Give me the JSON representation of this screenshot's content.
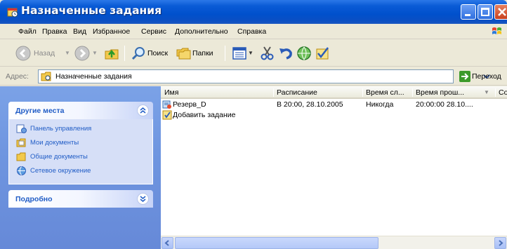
{
  "window": {
    "title": "Назначенные задания",
    "accent": "#0a5bd6"
  },
  "menu": [
    "Файл",
    "Правка",
    "Вид",
    "Избранное",
    "Сервис",
    "Дополнительно",
    "Справка"
  ],
  "toolbar": {
    "back_label": "Назад",
    "search_label": "Поиск",
    "folders_label": "Папки"
  },
  "address": {
    "label": "Адрес:",
    "value": "Назначенные задания",
    "go_label": "Переход"
  },
  "taskpane": {
    "other_places": {
      "title": "Другие места",
      "links": [
        "Панель управления",
        "Мои документы",
        "Общие документы",
        "Сетевое окружение"
      ]
    },
    "details": {
      "title": "Подробно"
    }
  },
  "filelist": {
    "columns": [
      "Имя",
      "Расписание",
      "Время сл...",
      "Время прош...",
      "Со"
    ],
    "rows": [
      {
        "name": "Резерв_D",
        "schedule": "В 20:00, 28.10.2005",
        "next_run": "Никогда",
        "last_run": "20:00:00  28.10....",
        "icon": "scheduled-task-icon"
      },
      {
        "name": "Добавить задание",
        "schedule": "",
        "next_run": "",
        "last_run": "",
        "icon": "add-task-icon"
      }
    ]
  }
}
